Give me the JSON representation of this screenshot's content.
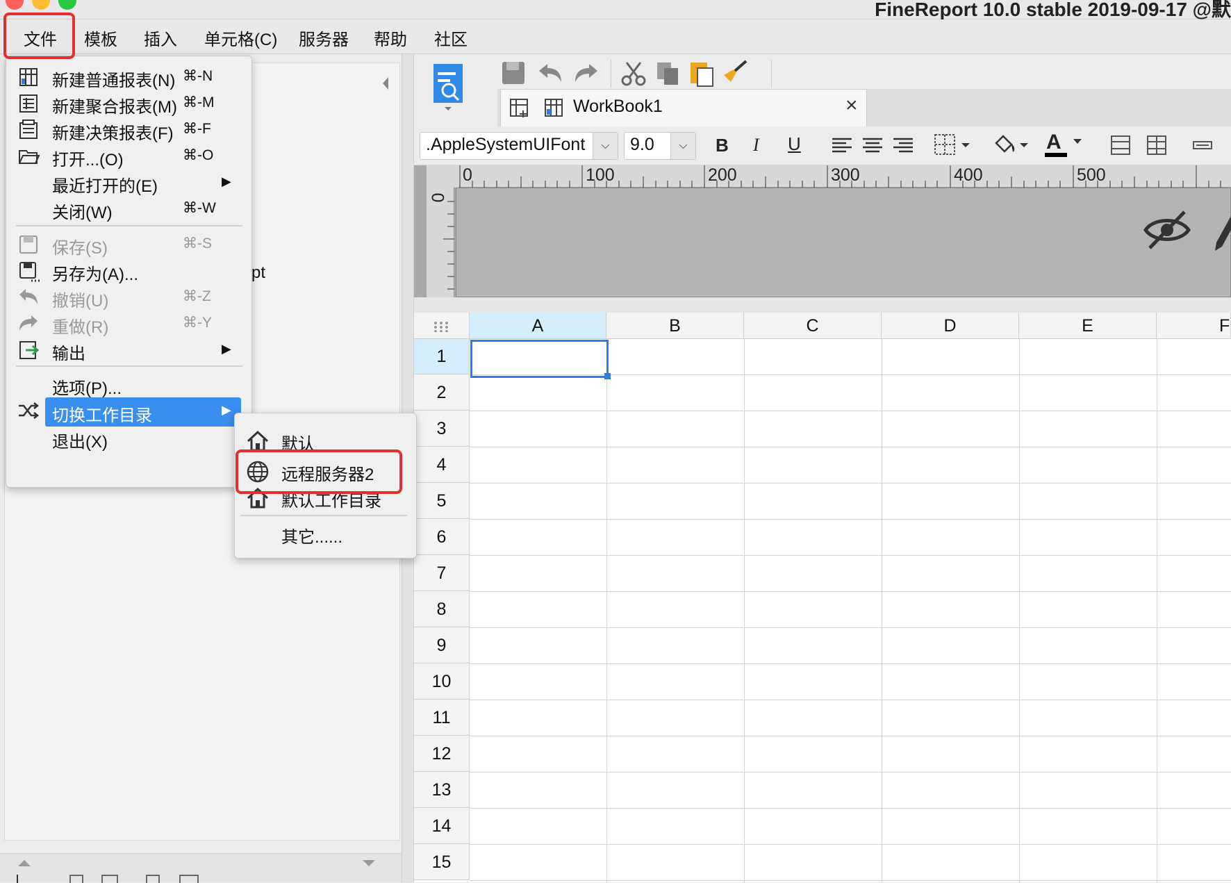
{
  "window": {
    "title": "FineReport 10.0 stable 2019-09-17 @默",
    "traffic_colors": [
      "#fe5f57",
      "#febc2e",
      "#28c840"
    ]
  },
  "menubar": {
    "items": [
      "文件",
      "模板",
      "插入",
      "单元格(C)",
      "服务器",
      "帮助",
      "社区"
    ]
  },
  "file_menu": {
    "items": [
      {
        "label": "新建普通报表(N)",
        "shortcut": "⌘-N",
        "icon": "grid-report-icon",
        "enabled": true
      },
      {
        "label": "新建聚合报表(M)",
        "shortcut": "⌘-M",
        "icon": "aggregate-report-icon",
        "enabled": true
      },
      {
        "label": "新建决策报表(F)",
        "shortcut": "⌘-F",
        "icon": "decision-report-icon",
        "enabled": true
      },
      {
        "label": "打开...(O)",
        "shortcut": "⌘-O",
        "icon": "folder-open-icon",
        "enabled": true
      },
      {
        "label": "最近打开的(E)",
        "shortcut": "",
        "icon": "",
        "enabled": true,
        "submenu": true
      },
      {
        "label": "关闭(W)",
        "shortcut": "⌘-W",
        "icon": "",
        "enabled": true
      },
      {
        "label": "保存(S)",
        "shortcut": "⌘-S",
        "icon": "save-icon",
        "enabled": false
      },
      {
        "label": "另存为(A)...",
        "shortcut": "",
        "icon": "save-as-icon",
        "enabled": true
      },
      {
        "label": "撤销(U)",
        "shortcut": "⌘-Z",
        "icon": "undo-icon",
        "enabled": false
      },
      {
        "label": "重做(R)",
        "shortcut": "⌘-Y",
        "icon": "redo-icon",
        "enabled": false
      },
      {
        "label": "输出",
        "shortcut": "",
        "icon": "export-icon",
        "enabled": true,
        "submenu": true
      },
      {
        "label": "选项(P)...",
        "shortcut": "",
        "icon": "",
        "enabled": true
      },
      {
        "label": "切换工作目录",
        "shortcut": "",
        "icon": "shuffle-icon",
        "enabled": true,
        "submenu": true,
        "selected": true
      },
      {
        "label": "退出(X)",
        "shortcut": "",
        "icon": "",
        "enabled": true
      }
    ]
  },
  "workdir_submenu": {
    "items": [
      {
        "label": "默认",
        "icon": "home-icon"
      },
      {
        "label": "远程服务器2",
        "icon": "globe-icon"
      },
      {
        "label": "默认工作目录",
        "icon": "home-icon"
      },
      {
        "label": "其它......",
        "icon": ""
      }
    ]
  },
  "left_panel": {
    "partial_text": "pt"
  },
  "tab": {
    "label": "WorkBook1",
    "close": "×"
  },
  "format_bar": {
    "font_name": ".AppleSystemUIFont",
    "font_size": "9.0",
    "bold": "B",
    "italic": "I",
    "underline": "U",
    "font_color_letter": "A"
  },
  "ruler": {
    "zero": "0",
    "ticks": [
      "0",
      "100",
      "200",
      "300",
      "400",
      "500"
    ]
  },
  "sheet": {
    "columns": [
      "A",
      "B",
      "C",
      "D",
      "E",
      "F"
    ],
    "rows": [
      "1",
      "2",
      "3",
      "4",
      "5",
      "6",
      "7",
      "8",
      "9",
      "10",
      "11",
      "12",
      "13",
      "14",
      "15"
    ],
    "selected_cell": "A1"
  },
  "colors": {
    "highlight_red": "#e0312f",
    "menu_selection": "#3a8ef0",
    "cell_selection": "#2f7de3",
    "column_selected": "#d6eefb"
  }
}
